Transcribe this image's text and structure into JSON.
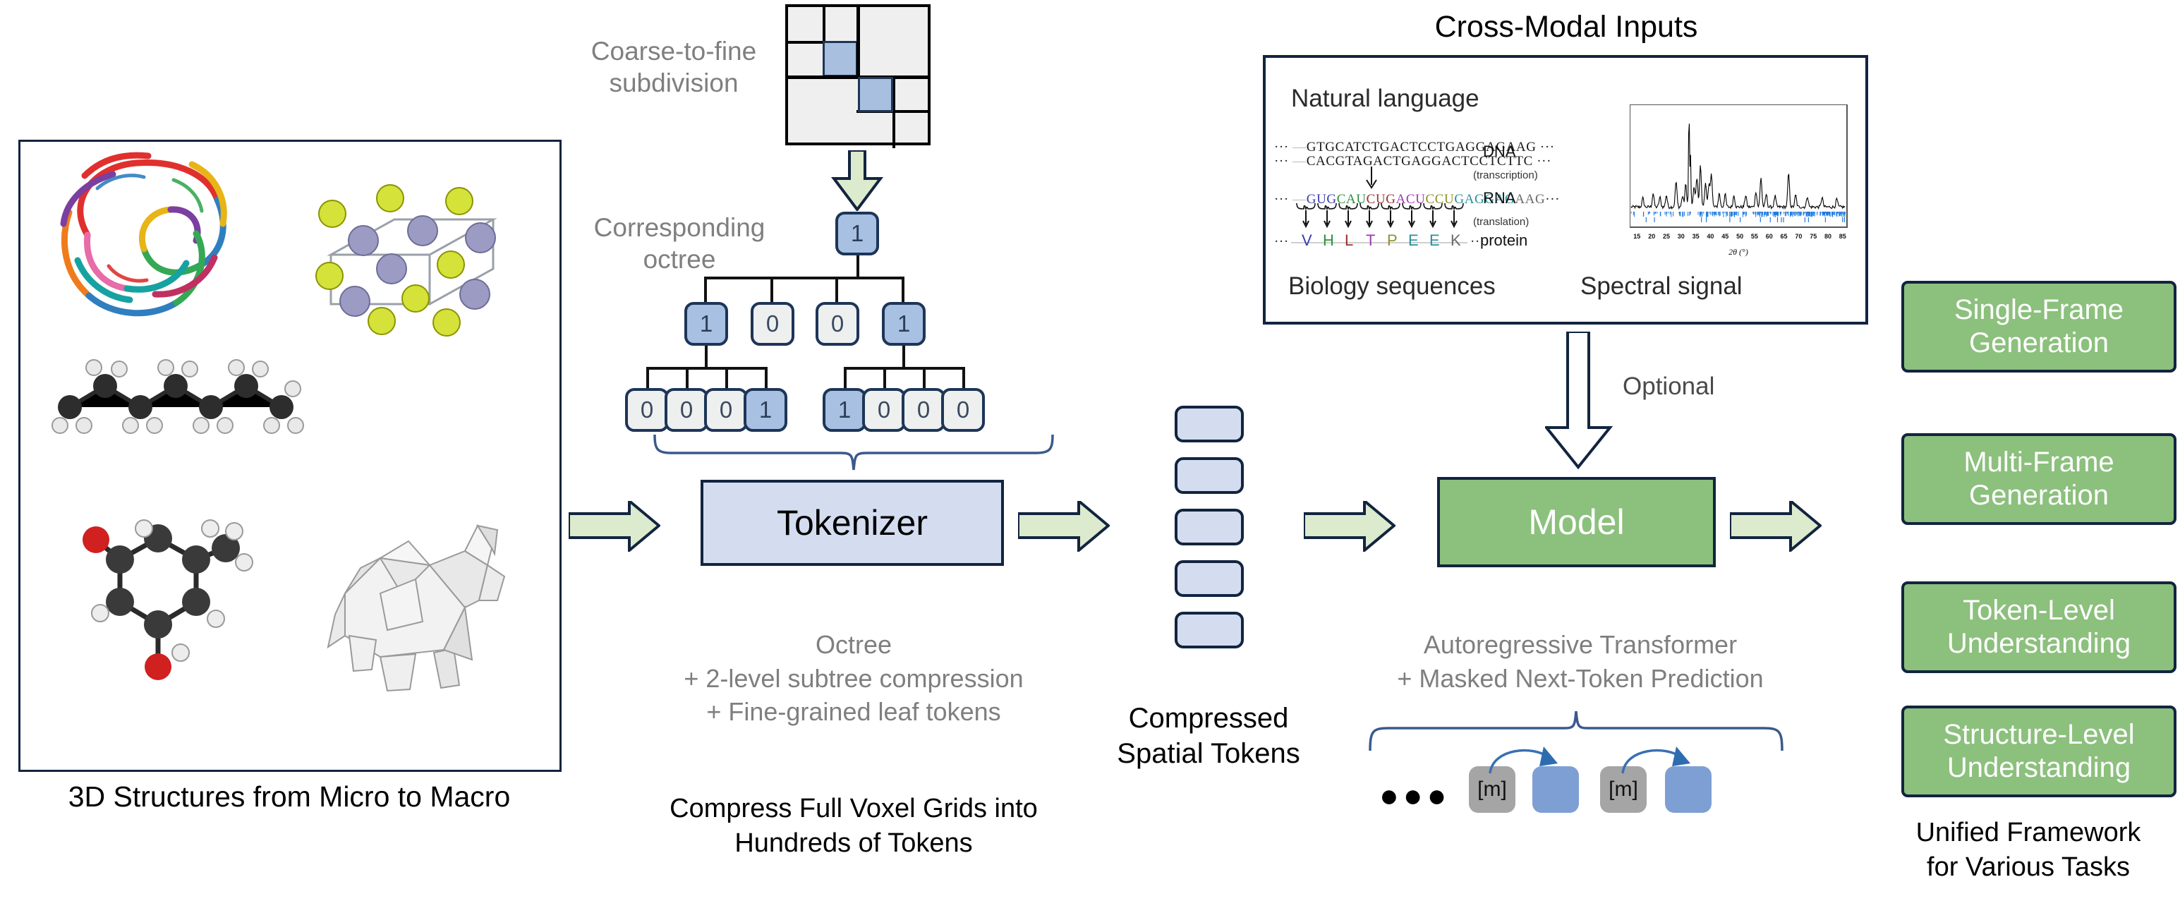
{
  "left_panel": {
    "caption": "3D Structures from Micro to Macro",
    "items": [
      {
        "name": "protein-ribbon-structure"
      },
      {
        "name": "crystal-lattice-structure"
      },
      {
        "name": "alkane-chain-molecule"
      },
      {
        "name": "organic-molecule-ball-and-stick"
      },
      {
        "name": "low-poly-dog-mesh"
      }
    ]
  },
  "tokenizer_column": {
    "coarse_label": "Coarse-to-fine subdivision",
    "octree_label": "Corresponding octree",
    "quadtree": {
      "name": "coarse-to-fine-quadtree",
      "occupied_cells": [
        "top-left-quadrant-br",
        "bottom-right-quadrant-tl"
      ]
    },
    "tree": {
      "root": "1",
      "level2": [
        "1",
        "0",
        "0",
        "1"
      ],
      "level3_left": [
        "0",
        "0",
        "0",
        "1"
      ],
      "level3_right": [
        "1",
        "0",
        "0",
        "0"
      ]
    },
    "box_label": "Tokenizer",
    "sub_lines": [
      "Octree",
      "+ 2-level subtree compression",
      "+ Fine-grained leaf tokens"
    ],
    "caption_lines": [
      "Compress Full Voxel Grids into",
      "Hundreds of Tokens"
    ]
  },
  "compressed_tokens": {
    "caption_lines": [
      "Compressed",
      "Spatial Tokens"
    ],
    "count": 5
  },
  "cross_modal": {
    "title": "Cross-Modal Inputs",
    "natural_language_label": "Natural language",
    "biology_label": "Biology sequences",
    "spectral_label": "Spectral signal",
    "central_dogma": {
      "dna_top": "GTGCATCTGACTCCTGAGGAGAAG",
      "dna_bottom": "CACGTAGACTGAGGACTCCTCTTC",
      "dna_label": "DNA",
      "transcription_label": "(transcription)",
      "rna_codons": [
        "GUG",
        "CAU",
        "CUG",
        "ACU",
        "CCU",
        "GAG",
        "GAG",
        "AAG"
      ],
      "rna_label": "RNA",
      "translation_label": "(translation)",
      "protein_residues": [
        "V",
        "H",
        "L",
        "T",
        "P",
        "E",
        "E",
        "K"
      ],
      "protein_label": "protein",
      "leading_ellipsis": "···",
      "trailing_ellipsis": "···"
    }
  },
  "chart_data": {
    "type": "line",
    "name": "xrd-spectral-signal",
    "title": "",
    "xlabel": "2θ (°)",
    "ylabel": "",
    "xlim": [
      13,
      86
    ],
    "xticks": [
      15,
      20,
      25,
      30,
      35,
      40,
      45,
      50,
      55,
      60,
      65,
      70,
      75,
      80,
      85
    ],
    "xticklabels": [
      "15",
      "20",
      "25",
      "30",
      "35",
      "40",
      "45",
      "50",
      "55",
      "60",
      "65",
      "70",
      "75",
      "80",
      "85"
    ],
    "grid": false,
    "legend": "none",
    "series": [
      {
        "name": "intensity",
        "color": "#000000",
        "peaks": [
          {
            "x": 17.0,
            "y": 9
          },
          {
            "x": 20.5,
            "y": 14
          },
          {
            "x": 22.8,
            "y": 10
          },
          {
            "x": 25.0,
            "y": 12
          },
          {
            "x": 28.3,
            "y": 26
          },
          {
            "x": 30.5,
            "y": 11
          },
          {
            "x": 31.6,
            "y": 23
          },
          {
            "x": 32.7,
            "y": 100
          },
          {
            "x": 33.2,
            "y": 55
          },
          {
            "x": 34.4,
            "y": 20
          },
          {
            "x": 35.4,
            "y": 30
          },
          {
            "x": 36.6,
            "y": 42
          },
          {
            "x": 38.3,
            "y": 25
          },
          {
            "x": 39.5,
            "y": 22
          },
          {
            "x": 40.3,
            "y": 34
          },
          {
            "x": 43.0,
            "y": 14
          },
          {
            "x": 45.0,
            "y": 13
          },
          {
            "x": 48.0,
            "y": 12
          },
          {
            "x": 52.0,
            "y": 12
          },
          {
            "x": 55.5,
            "y": 16
          },
          {
            "x": 57.2,
            "y": 30
          },
          {
            "x": 59.0,
            "y": 13
          },
          {
            "x": 62.0,
            "y": 11
          },
          {
            "x": 66.6,
            "y": 34
          },
          {
            "x": 69.0,
            "y": 12
          },
          {
            "x": 73.0,
            "y": 11
          },
          {
            "x": 78.0,
            "y": 10
          },
          {
            "x": 83.0,
            "y": 8
          }
        ],
        "baseline": 6
      },
      {
        "name": "reference-reflections",
        "color": "#1f7ae0",
        "kind": "tick-marks"
      }
    ]
  },
  "model_column": {
    "optional_label": "Optional",
    "box_label": "Model",
    "sub_lines": [
      "Autoregressive Transformer",
      "+ Masked Next-Token Prediction"
    ],
    "sequence": {
      "leading_dots": "●●●",
      "tokens": [
        {
          "label": "[m]",
          "kind": "mask"
        },
        {
          "label": "",
          "kind": "pred"
        },
        {
          "label": "[m]",
          "kind": "mask"
        },
        {
          "label": "",
          "kind": "pred"
        }
      ]
    }
  },
  "tasks": {
    "items": [
      {
        "line1": "Single-Frame",
        "line2": "Generation"
      },
      {
        "line1": "Multi-Frame",
        "line2": "Generation"
      },
      {
        "line1": "Token-Level",
        "line2": "Understanding"
      },
      {
        "line1": "Structure-Level",
        "line2": "Understanding"
      }
    ],
    "caption_lines": [
      "Unified Framework",
      "for Various Tasks"
    ]
  },
  "colors": {
    "accent_blue": "#a8c0e2",
    "token_blue": "#d4ddf0",
    "accent_green": "#8cc07d",
    "arrow_green": "#dceace",
    "outline_navy": "#12243f",
    "grey_text": "#7f7f7f",
    "mask_grey": "#a5a5a5",
    "pred_blue": "#7e9fd4"
  }
}
